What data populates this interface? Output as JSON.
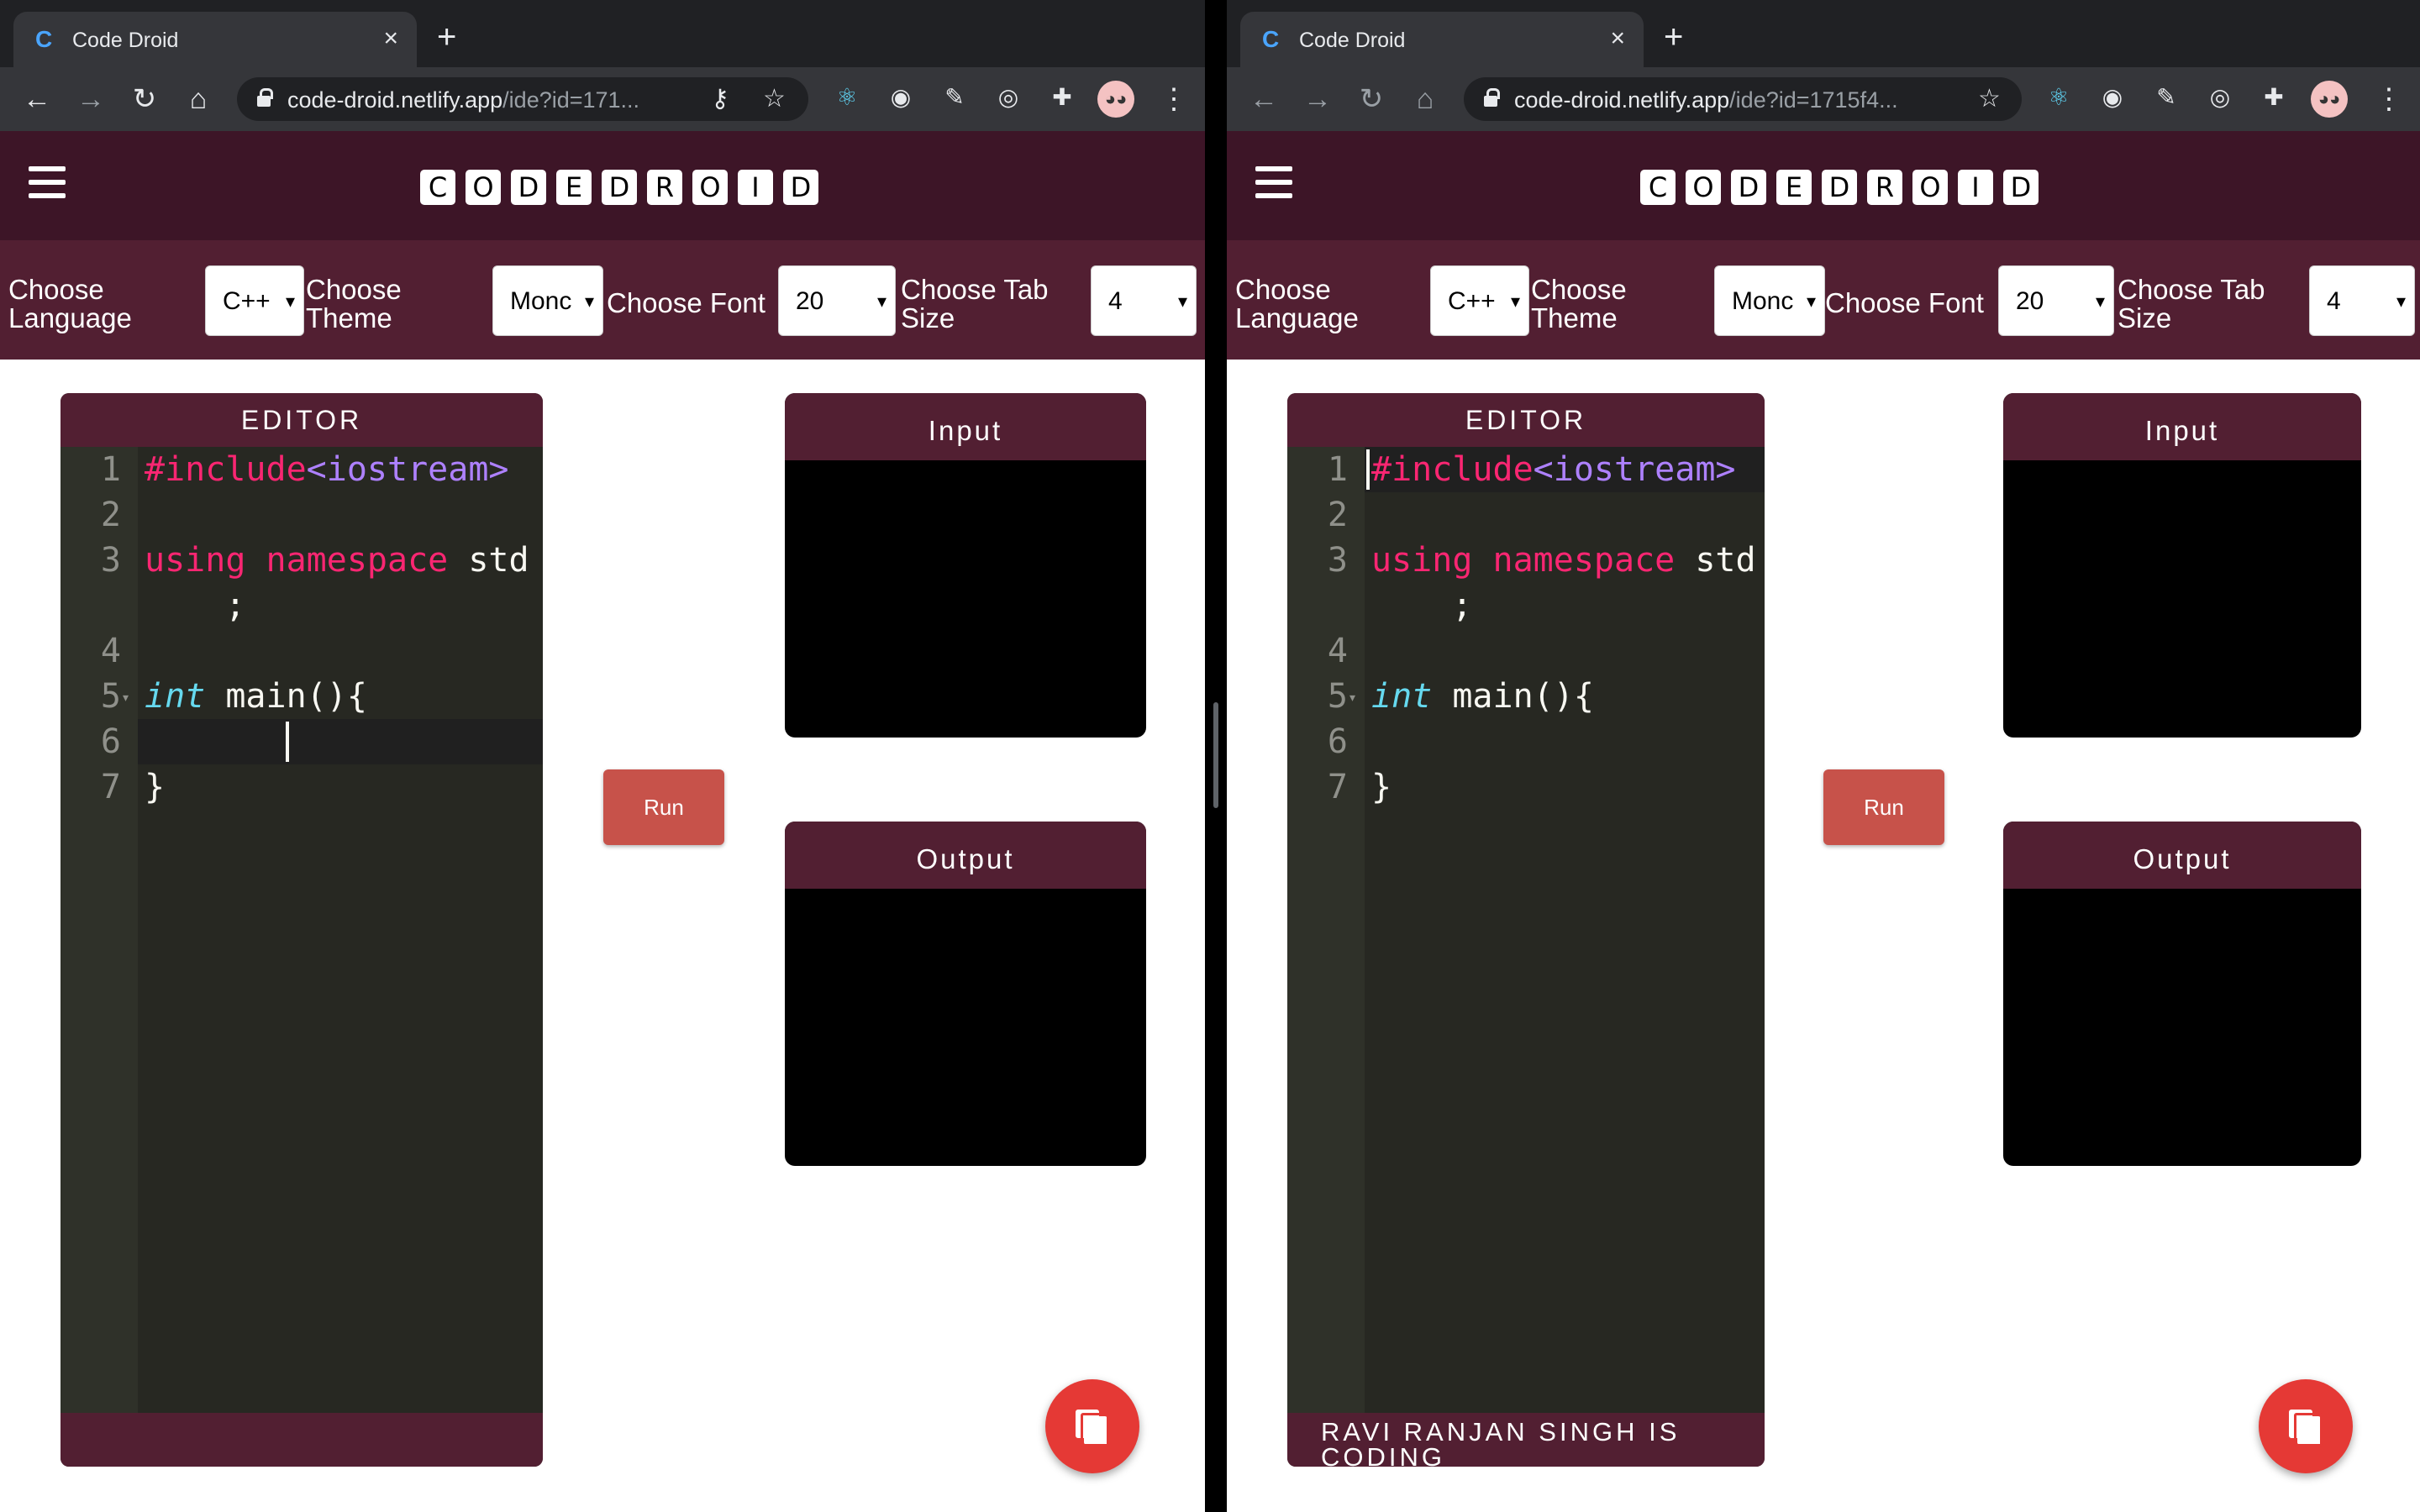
{
  "browser": {
    "tab_title": "Code Droid",
    "tab_close": "×",
    "new_tab": "+",
    "url_left_host": "code-droid.netlify.app",
    "url_left_path": "/ide?id=171...",
    "url_right_host": "code-droid.netlify.app",
    "url_right_path": "/ide?id=1715f4..."
  },
  "app": {
    "logo_letters": [
      "C",
      "O",
      "D",
      "E",
      "D",
      "R",
      "O",
      "I",
      "D"
    ],
    "settings": {
      "language_label": "Choose Language",
      "language_value": "C++",
      "theme_label": "Choose Theme",
      "theme_value": "Monc",
      "font_label": "Choose Font",
      "font_value": "20",
      "tab_label": "Choose Tab Size",
      "tab_value": "4"
    },
    "editor_title": "EDITOR",
    "run_label": "Run",
    "input_title": "Input",
    "output_title": "Output",
    "footer_right": "RAVI RANJAN SINGH IS CODING",
    "footer_left": "",
    "code_lines": {
      "l1_directive": "#include",
      "l1_header": "<iostream>",
      "l3_kw1": "using",
      "l3_kw2": "namespace",
      "l3_rest": " std",
      "l3_wrap": ";",
      "l5_type": "int",
      "l5_rest": " main(){",
      "l7": "}"
    },
    "line_numbers": [
      "1",
      "2",
      "3",
      "4",
      "5",
      "6",
      "7"
    ]
  },
  "colors": {
    "appbar": "#3d1527",
    "settings_bar": "#521f32",
    "editor_bg": "#272822",
    "run_button": "#c7524a",
    "fab": "#e53935"
  }
}
